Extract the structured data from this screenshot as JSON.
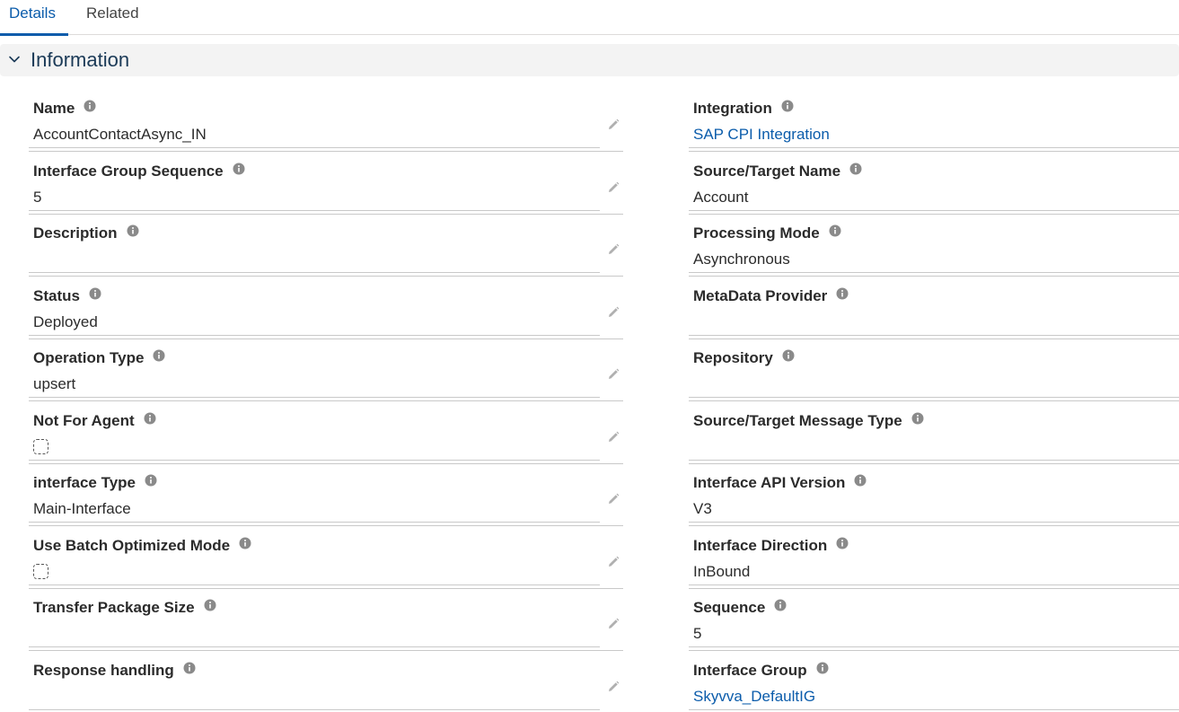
{
  "tabs": {
    "details": "Details",
    "related": "Related"
  },
  "section": {
    "title": "Information"
  },
  "left_fields": [
    {
      "label": "Name",
      "value": "AccountContactAsync_IN"
    },
    {
      "label": "Interface Group Sequence",
      "value": "5"
    },
    {
      "label": "Description",
      "value": ""
    },
    {
      "label": "Status",
      "value": "Deployed"
    },
    {
      "label": "Operation Type",
      "value": "upsert"
    },
    {
      "label": "Not For Agent",
      "value": ""
    },
    {
      "label": "interface Type",
      "value": "Main-Interface"
    },
    {
      "label": "Use Batch Optimized Mode",
      "value": ""
    },
    {
      "label": "Transfer Package Size",
      "value": ""
    },
    {
      "label": "Response handling",
      "value": ""
    }
  ],
  "right_fields": [
    {
      "label": "Integration",
      "value": "SAP CPI Integration"
    },
    {
      "label": "Source/Target Name",
      "value": "Account"
    },
    {
      "label": "Processing Mode",
      "value": "Asynchronous"
    },
    {
      "label": "MetaData Provider",
      "value": ""
    },
    {
      "label": "Repository",
      "value": ""
    },
    {
      "label": "Source/Target Message Type",
      "value": ""
    },
    {
      "label": "Interface API Version",
      "value": "V3"
    },
    {
      "label": "Interface Direction",
      "value": "InBound"
    },
    {
      "label": "Sequence",
      "value": "5"
    },
    {
      "label": "Interface Group",
      "value": "Skyvva_DefaultIG"
    }
  ],
  "colors": {
    "accent": "#0b5cab",
    "section_bg": "#f3f3f3",
    "divider": "#c9c9c9"
  },
  "icons": {
    "info": "info-icon",
    "edit": "pencil-icon",
    "chevron": "chevron-down-icon"
  }
}
